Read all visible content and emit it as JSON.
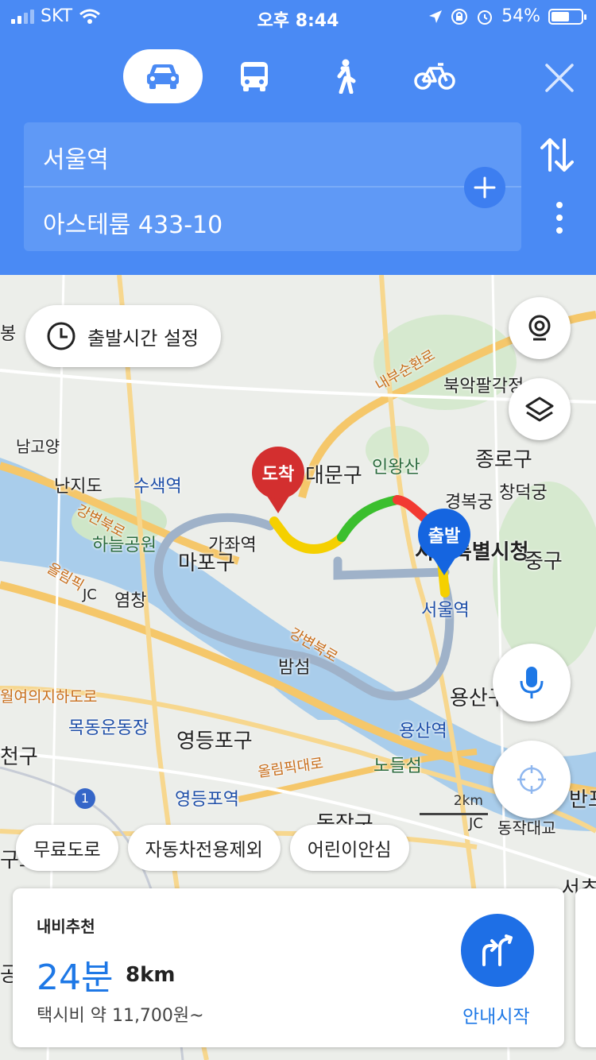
{
  "status_bar": {
    "carrier": "SKT",
    "time": "오후 8:44",
    "battery_percent": "54%"
  },
  "transport_modes": [
    {
      "name": "car",
      "icon": "car-icon",
      "active": true
    },
    {
      "name": "bus",
      "icon": "bus-icon",
      "active": false
    },
    {
      "name": "walk",
      "icon": "walk-icon",
      "active": false
    },
    {
      "name": "bike",
      "icon": "bike-icon",
      "active": false
    }
  ],
  "route": {
    "origin": "서울역",
    "destination": "아스테룸 433-10"
  },
  "map": {
    "departure_time_button": "출발시간 설정",
    "pins": {
      "destination": "도착",
      "origin": "출발"
    },
    "labels": {
      "bong": "봉",
      "namgoyang": "남고양",
      "nanjido": "난지도",
      "susaek": "수색역",
      "haneul_park": "하늘공원",
      "gangbyeonbuk": "강변북로",
      "olympic": "올림픽",
      "jc": "JC",
      "yeomchang": "염창",
      "gajwa": "가좌역",
      "mapo": "마포구",
      "seodaemun": "대문구",
      "inwangsan": "인왕산",
      "naebusunhwan": "내부순환로",
      "bugak": "북악팔각정",
      "jongno": "종로구",
      "gyeongbok": "경복궁",
      "changdeok": "창덕궁",
      "cityhall": "서울특별시청",
      "jung": "중구",
      "seoulstation": "서울역",
      "bamseom": "밤섬",
      "gangbyeonbuk2": "강변북로",
      "yeouido_tunnel": "월여의지하도로",
      "mokdong": "목동운동장",
      "yeongdeungpo_gu": "영등포구",
      "olympic2": "올림픽대로",
      "yeongdeungpo_st": "영등포역",
      "yongsan_gu": "용산구",
      "yongsan_st": "용산역",
      "nodeulseom": "노들섬",
      "dongjak": "동작구",
      "dongjak_bridge": "동작대교",
      "cheon": "천구",
      "gong": "공",
      "banpo": "반포",
      "gurou": "구로",
      "seocho": "서초",
      "route1": "1"
    },
    "scale": "2km"
  },
  "filters": [
    "무료도로",
    "자동차전용제외",
    "어린이안심"
  ],
  "recommendation": {
    "title": "내비추천",
    "eta": "24분",
    "distance": "8km",
    "taxi_fare": "택시비 약 11,700원~",
    "start_label": "안내시작"
  },
  "colors": {
    "header_blue": "#4a8af4",
    "accent_blue": "#1e78e6",
    "destination_red": "#d32f2f",
    "origin_blue": "#1565e0",
    "traffic_yellow": "#f5d000",
    "traffic_green": "#3bbf2e",
    "traffic_red": "#f23a32",
    "alt_route": "#9fb2c9"
  }
}
